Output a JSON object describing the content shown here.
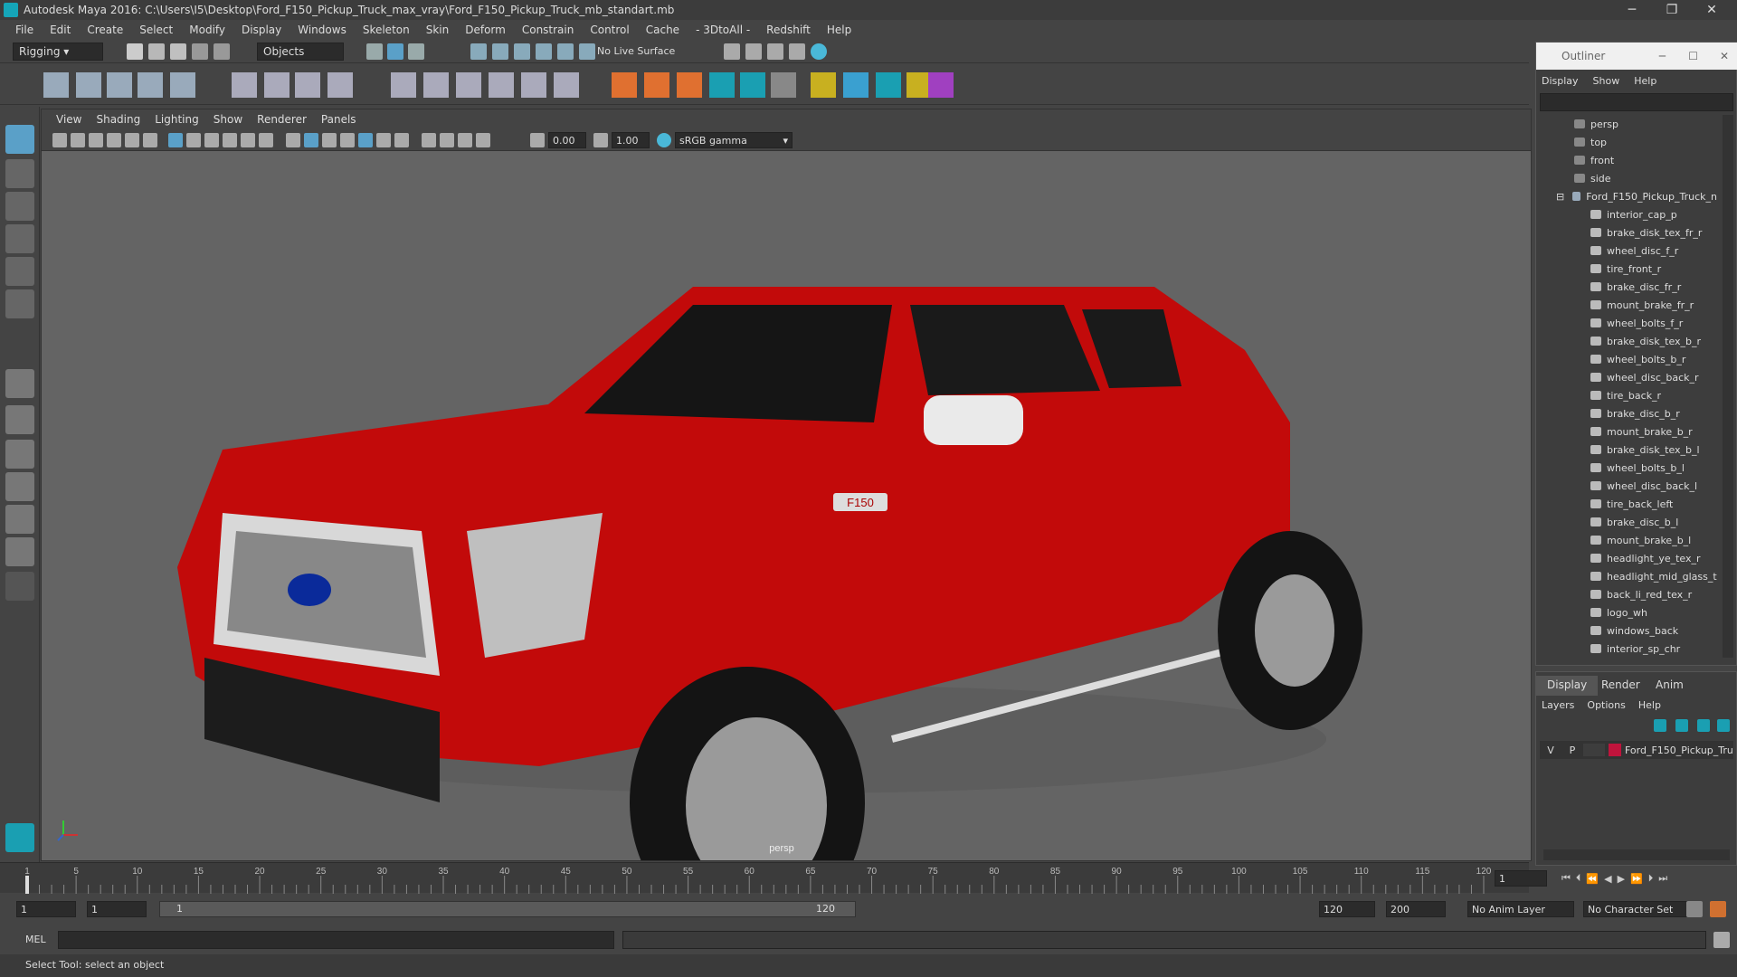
{
  "app": {
    "title": "Autodesk Maya 2016: C:\\Users\\I5\\Desktop\\Ford_F150_Pickup_Truck_max_vray\\Ford_F150_Pickup_Truck_mb_standart.mb"
  },
  "menu": [
    "File",
    "Edit",
    "Create",
    "Select",
    "Modify",
    "Display",
    "Windows",
    "Skeleton",
    "Skin",
    "Deform",
    "Constrain",
    "Control",
    "Cache",
    "- 3DtoAll -",
    "Redshift",
    "Help"
  ],
  "status": {
    "mode": "Rigging",
    "select_mode": "Objects",
    "live_surface": "No Live Surface"
  },
  "viewport": {
    "menu": [
      "View",
      "Shading",
      "Lighting",
      "Show",
      "Renderer",
      "Panels"
    ],
    "near": "0.00",
    "far": "1.00",
    "color_space": "sRGB gamma",
    "camera_label": "persp",
    "badge_text": "F150"
  },
  "outliner": {
    "title": "Outliner",
    "menu": [
      "Display",
      "Show",
      "Help"
    ],
    "cameras": [
      "persp",
      "top",
      "front",
      "side"
    ],
    "root": "Ford_F150_Pickup_Truck_n",
    "children": [
      "interior_cap_p",
      "brake_disk_tex_fr_r",
      "wheel_disc_f_r",
      "tire_front_r",
      "brake_disc_fr_r",
      "mount_brake_fr_r",
      "wheel_bolts_f_r",
      "brake_disk_tex_b_r",
      "wheel_bolts_b_r",
      "wheel_disc_back_r",
      "tire_back_r",
      "brake_disc_b_r",
      "mount_brake_b_r",
      "brake_disk_tex_b_l",
      "wheel_bolts_b_l",
      "wheel_disc_back_l",
      "tire_back_left",
      "brake_disc_b_l",
      "mount_brake_b_l",
      "headlight_ye_tex_r",
      "headlight_mid_glass_t",
      "back_li_red_tex_r",
      "logo_wh",
      "windows_back",
      "interior_sp_chr"
    ]
  },
  "layers": {
    "tabs": [
      "Display",
      "Render",
      "Anim"
    ],
    "menu": [
      "Layers",
      "Options",
      "Help"
    ],
    "layer": {
      "v": "V",
      "p": "P",
      "name": "Ford_F150_Pickup_Tru",
      "color": "#c0143c"
    }
  },
  "timeline": {
    "ticks": [
      "1",
      "5",
      "10",
      "15",
      "20",
      "25",
      "30",
      "35",
      "40",
      "45",
      "50",
      "55",
      "60",
      "65",
      "70",
      "75",
      "80",
      "85",
      "90",
      "95",
      "100",
      "105",
      "110",
      "115",
      "120"
    ],
    "current": "1"
  },
  "range": {
    "start": "1",
    "start2": "1",
    "slider_start": "1",
    "slider_end": "120",
    "end": "120",
    "end2": "200",
    "anim_layer": "No Anim Layer",
    "char_set": "No Character Set"
  },
  "cmd": {
    "label": "MEL"
  },
  "help": "Select Tool: select an object",
  "colors": {
    "truck": "#d40a0a",
    "accent": "#15a5b8"
  }
}
